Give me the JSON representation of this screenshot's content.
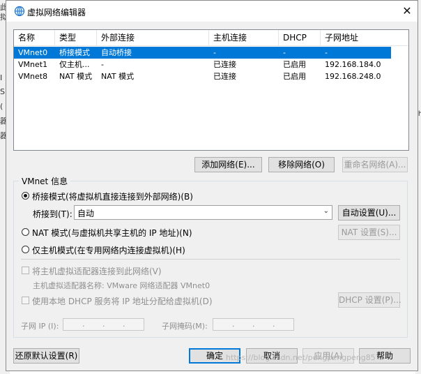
{
  "background": {
    "left_fragments": [
      "此",
      "拟",
      "I",
      "S",
      "(",
      "器",
      "器"
    ],
    "right_fragment": "th"
  },
  "window": {
    "title": "虚拟网络编辑器",
    "close_glyph": "✕",
    "accent_color": "#0078d7"
  },
  "network_table": {
    "columns": [
      "名称",
      "类型",
      "外部连接",
      "主机连接",
      "DHCP",
      "子网地址"
    ],
    "rows": [
      [
        "VMnet0",
        "桥接模式",
        "自动桥接",
        "-",
        "-",
        "-"
      ],
      [
        "VMnet1",
        "仅主机...",
        "-",
        "已连接",
        "已启用",
        "192.168.184.0"
      ],
      [
        "VMnet8",
        "NAT 模式",
        "NAT 模式",
        "已连接",
        "已启用",
        "192.168.248.0"
      ]
    ],
    "selected_row": 0
  },
  "list_buttons": {
    "add": "添加网络(E)...",
    "remove": "移除网络(O)",
    "rename": "重命名网络(A)..."
  },
  "vmnet_info": {
    "group_label": "VMnet 信息",
    "bridged_radio": "桥接模式(将虚拟机直接连接到外部网络)(B)",
    "bridged_to_label": "桥接到(T):",
    "bridged_to_value": "自动",
    "auto_settings_button": "自动设置(U)...",
    "nat_radio": "NAT 模式(与虚拟机共享主机的 IP 地址)(N)",
    "nat_settings_button": "NAT 设置(S)...",
    "hostonly_radio": "仅主机模式(在专用网络内连接虚拟机)(H)",
    "selected_mode": "bridged",
    "connect_adapter_checkbox": "将主机虚拟适配器连接到此网络(V)",
    "adapter_name_text": "主机虚拟适配器名称: VMware 网络适配器 VMnet0",
    "dhcp_checkbox": "使用本地 DHCP 服务将 IP 地址分配给虚拟机(D)",
    "dhcp_settings_button": "DHCP 设置(P)...",
    "subnet_ip_label": "子网 IP (I):",
    "subnet_mask_label": "子网掩码(M):",
    "ip_dot": "."
  },
  "footer": {
    "restore_defaults": "还原默认设置(R)",
    "ok": "确定",
    "cancel": "取消",
    "apply": "应用(A)",
    "help": "帮助"
  },
  "watermark": "https://blog.csdn.net/pengpengpeng85"
}
